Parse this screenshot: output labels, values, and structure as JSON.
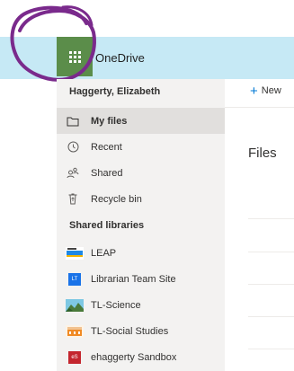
{
  "app": {
    "name": "OneDrive"
  },
  "sidebar": {
    "user_name": "Haggerty, Elizabeth",
    "nav": [
      {
        "label": "My files",
        "icon": "folder-icon",
        "selected": true
      },
      {
        "label": "Recent",
        "icon": "clock-icon"
      },
      {
        "label": "Shared",
        "icon": "people-icon"
      },
      {
        "label": "Recycle bin",
        "icon": "trash-icon"
      }
    ],
    "shared_libraries_title": "Shared libraries",
    "libraries": [
      {
        "label": "LEAP",
        "icon": "leap-logo-icon"
      },
      {
        "label": "Librarian Team Site",
        "icon_text": "LT",
        "color": "#1a73e8"
      },
      {
        "label": "TL-Science",
        "icon": "landscape-icon"
      },
      {
        "label": "TL-Social Studies",
        "icon": "buildings-icon"
      },
      {
        "label": "ehaggerty Sandbox",
        "icon_text": "eS",
        "color": "#c4262e"
      }
    ]
  },
  "main": {
    "new_label": "New",
    "files_title": "Files"
  },
  "colors": {
    "topbar": "#c6e9f5",
    "waffle": "#5b8d4a",
    "accent": "#0078d4",
    "annotation": "#7a2a8c"
  }
}
